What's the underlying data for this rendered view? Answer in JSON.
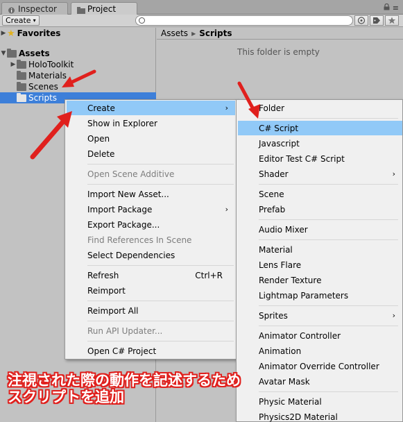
{
  "tabs": [
    {
      "label": "Inspector",
      "active": false
    },
    {
      "label": "Project",
      "active": true
    }
  ],
  "tabbar_controls": {
    "lock": "a",
    "menu": "≡"
  },
  "toolbar": {
    "create_label": "Create",
    "search_value": "",
    "search_placeholder": ""
  },
  "tree": {
    "favorites": "Favorites",
    "assets": "Assets",
    "children": [
      "HoloToolkit",
      "Materials",
      "Scenes",
      "Scripts"
    ],
    "selected": "Scripts"
  },
  "breadcrumb": [
    "Assets",
    "Scripts"
  ],
  "empty_message": "This folder is empty",
  "context_menu": {
    "items": [
      {
        "label": "Create",
        "submenu": true,
        "highlighted": true
      },
      {
        "label": "Show in Explorer"
      },
      {
        "label": "Open"
      },
      {
        "label": "Delete"
      },
      {
        "label": "Open Scene Additive",
        "disabled": true
      },
      {
        "label": "Import New Asset..."
      },
      {
        "label": "Import Package",
        "submenu": true
      },
      {
        "label": "Export Package..."
      },
      {
        "label": "Find References In Scene",
        "disabled": true
      },
      {
        "label": "Select Dependencies"
      },
      {
        "label": "Refresh",
        "shortcut": "Ctrl+R"
      },
      {
        "label": "Reimport"
      },
      {
        "label": "Reimport All"
      },
      {
        "label": "Run API Updater...",
        "disabled": true
      },
      {
        "label": "Open C# Project"
      }
    ]
  },
  "create_submenu": {
    "items": [
      {
        "label": "Folder"
      },
      {
        "label": "C# Script",
        "highlighted": true
      },
      {
        "label": "Javascript"
      },
      {
        "label": "Editor Test C# Script"
      },
      {
        "label": "Shader",
        "submenu": true
      },
      {
        "label": "Scene"
      },
      {
        "label": "Prefab"
      },
      {
        "label": "Audio Mixer"
      },
      {
        "label": "Material"
      },
      {
        "label": "Lens Flare"
      },
      {
        "label": "Render Texture"
      },
      {
        "label": "Lightmap Parameters"
      },
      {
        "label": "Sprites",
        "submenu": true
      },
      {
        "label": "Animator Controller"
      },
      {
        "label": "Animation"
      },
      {
        "label": "Animator Override Controller"
      },
      {
        "label": "Avatar Mask"
      },
      {
        "label": "Physic Material"
      },
      {
        "label": "Physics2D Material"
      }
    ]
  },
  "caption": {
    "line1": "注視された際の動作を記述するため",
    "line2": "スクリプトを追加"
  },
  "colors": {
    "selection": "#3d7fd9",
    "menu_highlight": "#91c9f7",
    "annotation": "#e0201d"
  }
}
